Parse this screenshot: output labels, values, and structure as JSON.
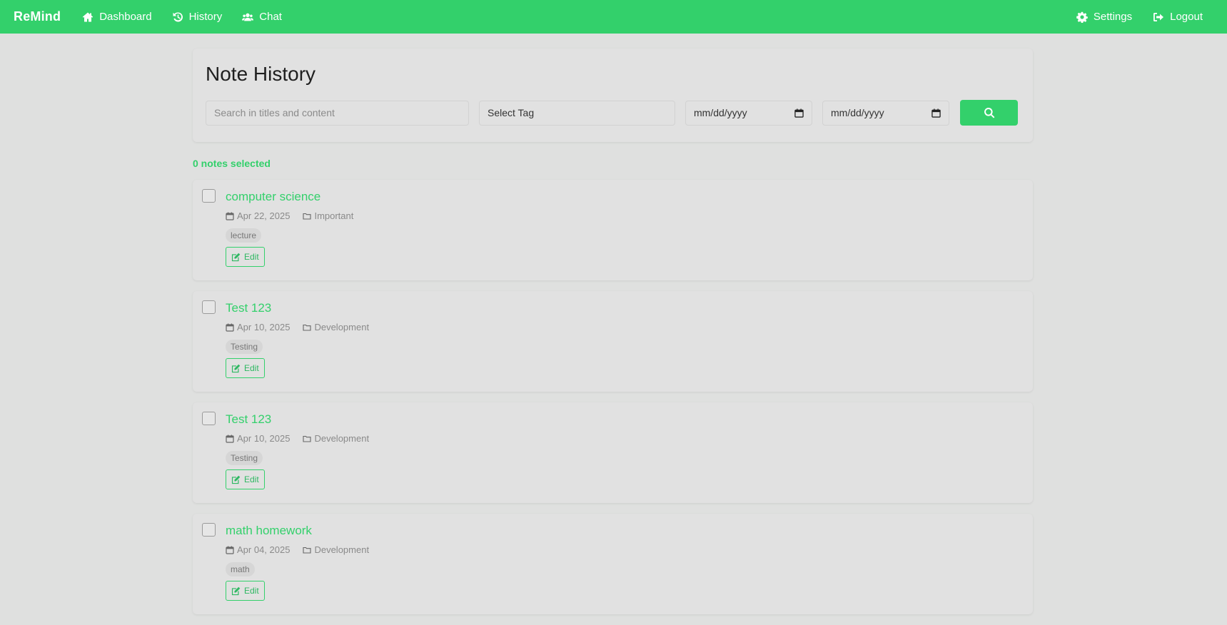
{
  "navbar": {
    "brand": "ReMind",
    "left_items": [
      {
        "label": "Dashboard",
        "icon": "home-icon"
      },
      {
        "label": "History",
        "icon": "history-icon"
      },
      {
        "label": "Chat",
        "icon": "users-icon"
      }
    ],
    "right_items": [
      {
        "label": "Settings",
        "icon": "gear-icon"
      },
      {
        "label": "Logout",
        "icon": "logout-icon"
      }
    ],
    "background": "#33d06b"
  },
  "page": {
    "title": "Note History",
    "search_placeholder": "Search in titles and content",
    "tag_select": "Select Tag",
    "date_from_placeholder": "mm/dd/yyyy",
    "date_to_placeholder": "mm/dd/yyyy",
    "selected_count": "0 notes selected"
  },
  "notes": [
    {
      "title": "computer science",
      "date": "Apr 22, 2025",
      "folder": "Important",
      "tag": "lecture",
      "edit_label": "Edit"
    },
    {
      "title": "Test 123",
      "date": "Apr 10, 2025",
      "folder": "Development",
      "tag": "Testing",
      "edit_label": "Edit"
    },
    {
      "title": "Test 123",
      "date": "Apr 10, 2025",
      "folder": "Development",
      "tag": "Testing",
      "edit_label": "Edit"
    },
    {
      "title": "math homework",
      "date": "Apr 04, 2025",
      "folder": "Development",
      "tag": "math",
      "edit_label": "Edit"
    }
  ],
  "colors": {
    "accent": "#33d06b",
    "background": "#dfe0df"
  }
}
